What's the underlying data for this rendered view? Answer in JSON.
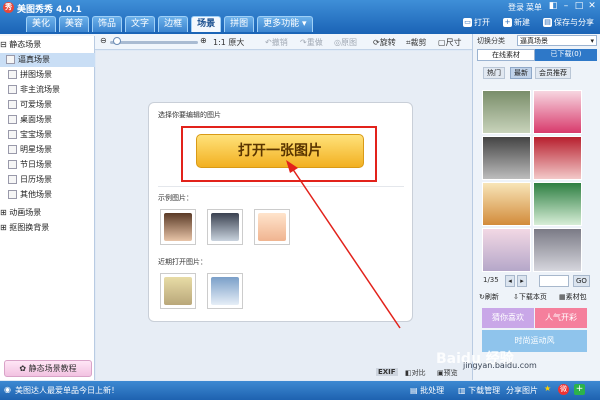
{
  "app": {
    "title": "美图秀秀 4.0.1",
    "logo_letter": "秀"
  },
  "topright": {
    "login": "登录",
    "menu": "菜单"
  },
  "tabs": [
    "美化",
    "美容",
    "饰品",
    "文字",
    "边框",
    "场景",
    "拼图",
    "更多功能"
  ],
  "toolbar_top": {
    "open": "打开",
    "new": "新建",
    "save_share": "保存与分享"
  },
  "toolbar": {
    "zoom_label": "1:1 原大",
    "undo": "撤销",
    "redo": "重做",
    "original": "原图",
    "rotate": "旋转",
    "crop": "裁剪",
    "size": "尺寸",
    "zoom_level": 0.02
  },
  "left": {
    "group_static": "静态场景",
    "items": [
      "逼真场景",
      "拼图场景",
      "非主流场景",
      "可爱场景",
      "桌面场景",
      "宝宝场景",
      "明星场景",
      "节日场景",
      "日历场景",
      "其他场景"
    ],
    "group_anim": "动画场景",
    "group_matte": "抠图换背景",
    "tutorial": "静态场景教程"
  },
  "center": {
    "prompt": "选择你要编辑的图片",
    "open_button": "打开一张图片",
    "examples_label": "示例图片：",
    "recent_label": "近期打开图片：",
    "exif": "EXIF",
    "compare": "对比",
    "preview": "预览"
  },
  "right": {
    "category_label": "切换分类",
    "category_value": "逼真场景",
    "tab_online": "在线素材",
    "tab_downloaded": "已下载(0)",
    "filters": [
      "热门",
      "最新",
      "会员推荐"
    ],
    "pagination": "1/35",
    "go": "GO",
    "refresh": "刷新",
    "download_page": "下载本页",
    "material_pack": "素材包",
    "banners": [
      "猜你喜欢",
      "人气开彩",
      "时尚运动风"
    ]
  },
  "status": {
    "news": "美图达人最爱单品今日上新！",
    "batch": "批处理",
    "download_mgr": "下载管理",
    "share": "分享图片"
  },
  "watermark": {
    "main": "Baidu 经验",
    "url": "jingyan.baidu.com"
  },
  "colors": {
    "accent": "#1a63b6",
    "highlight": "#e2221b",
    "button": "#f2b021"
  }
}
